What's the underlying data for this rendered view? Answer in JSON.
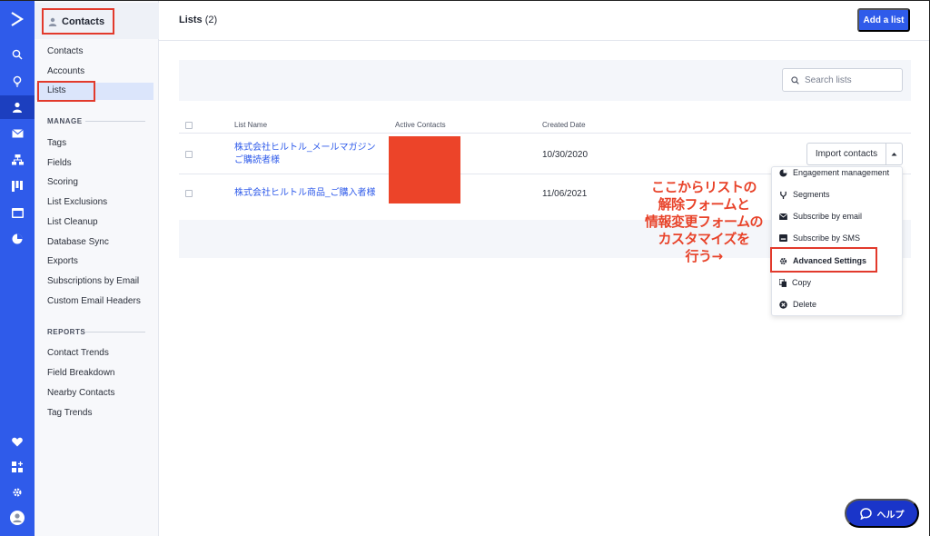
{
  "sidebar": {
    "heading": "Contacts",
    "nav": [
      "Contacts",
      "Accounts",
      "Lists"
    ],
    "manage_title": "MANAGE",
    "manage": [
      "Tags",
      "Fields",
      "Scoring",
      "List Exclusions",
      "List Cleanup",
      "Database Sync",
      "Exports",
      "Subscriptions by Email",
      "Custom Email Headers"
    ],
    "reports_title": "REPORTS",
    "reports": [
      "Contact Trends",
      "Field Breakdown",
      "Nearby Contacts",
      "Tag Trends"
    ]
  },
  "header": {
    "title": "Lists",
    "count": "(2)",
    "add_label": "Add a list"
  },
  "search": {
    "placeholder": "Search lists"
  },
  "table": {
    "columns": [
      "List Name",
      "Active Contacts",
      "Created Date"
    ],
    "rows": [
      {
        "name": "株式会社ヒルトル_メールマガジンご購読者様",
        "created": "10/30/2020"
      },
      {
        "name": "株式会社ヒルトル商品_ご購入者様",
        "created": "11/06/2021"
      }
    ]
  },
  "row_actions": {
    "import_label": "Import contacts",
    "menu": [
      "Engagement management",
      "Segments",
      "Subscribe by email",
      "Subscribe by SMS",
      "Advanced Settings",
      "Copy",
      "Delete"
    ]
  },
  "annotation": [
    "ここからリストの",
    "解除フォームと",
    "情報変更フォームの",
    "カスタマイズを",
    "行う→"
  ],
  "help": {
    "label": "ヘルプ"
  },
  "colors": {
    "brand": "#2f5bea",
    "highlight": "#e23a2c",
    "redaction": "#ec4429",
    "annotation": "#e8432a",
    "help": "#1a35c9"
  }
}
